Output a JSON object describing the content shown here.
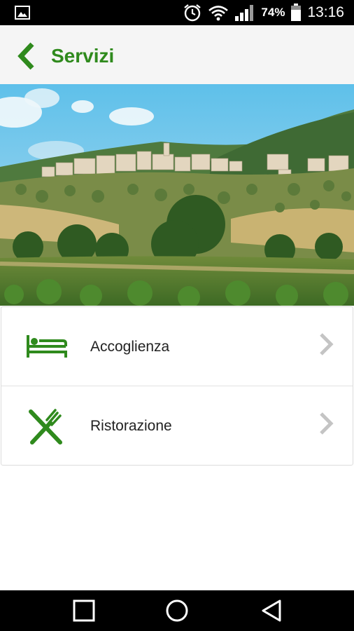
{
  "status_bar": {
    "battery_percent": "74%",
    "time": "13:16",
    "icons": [
      "gallery-icon",
      "alarm-icon",
      "wifi-icon",
      "signal-icon",
      "battery-icon"
    ]
  },
  "app_bar": {
    "title": "Servizi",
    "back_icon": "chevron-left-icon",
    "accent_color": "#2f8a1d"
  },
  "hero_image": {
    "subject": "hillside-village-landscape"
  },
  "menu": {
    "items": [
      {
        "label": "Accoglienza",
        "icon": "bed-icon"
      },
      {
        "label": "Ristorazione",
        "icon": "fork-knife-icon"
      }
    ],
    "chevron_icon": "chevron-right-icon"
  },
  "nav_bar": {
    "icons": [
      "recent-apps-icon",
      "home-icon",
      "back-icon"
    ]
  }
}
